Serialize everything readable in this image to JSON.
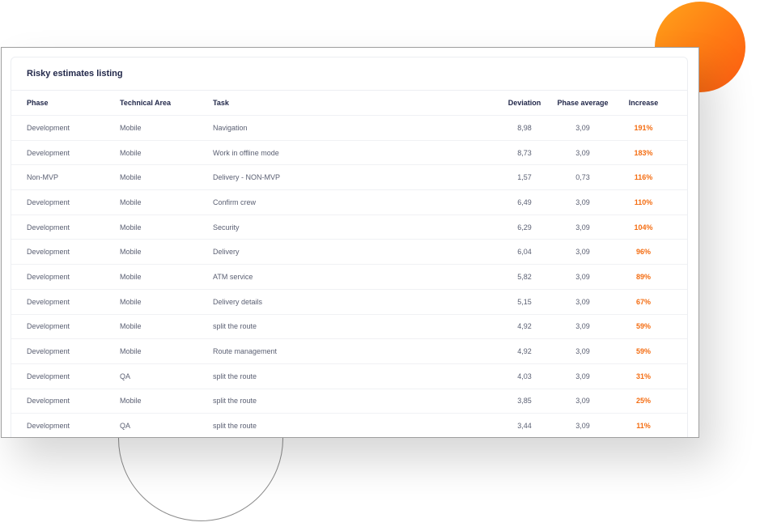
{
  "card": {
    "title": "Risky estimates listing"
  },
  "table": {
    "headers": {
      "phase": "Phase",
      "area": "Technical Area",
      "task": "Task",
      "deviation": "Deviation",
      "average": "Phase average",
      "increase": "Increase"
    },
    "rows": [
      {
        "phase": "Development",
        "area": "Mobile",
        "task": "Navigation",
        "deviation": "8,98",
        "average": "3,09",
        "increase": "191%"
      },
      {
        "phase": "Development",
        "area": "Mobile",
        "task": "Work in offline mode",
        "deviation": "8,73",
        "average": "3,09",
        "increase": "183%"
      },
      {
        "phase": "Non-MVP",
        "area": "Mobile",
        "task": "Delivery - NON-MVP",
        "deviation": "1,57",
        "average": "0,73",
        "increase": "116%"
      },
      {
        "phase": "Development",
        "area": "Mobile",
        "task": "Confirm crew",
        "deviation": "6,49",
        "average": "3,09",
        "increase": "110%"
      },
      {
        "phase": "Development",
        "area": "Mobile",
        "task": "Security",
        "deviation": "6,29",
        "average": "3,09",
        "increase": "104%"
      },
      {
        "phase": "Development",
        "area": "Mobile",
        "task": "Delivery",
        "deviation": "6,04",
        "average": "3,09",
        "increase": "96%"
      },
      {
        "phase": "Development",
        "area": "Mobile",
        "task": "ATM service",
        "deviation": "5,82",
        "average": "3,09",
        "increase": "89%"
      },
      {
        "phase": "Development",
        "area": "Mobile",
        "task": "Delivery details",
        "deviation": "5,15",
        "average": "3,09",
        "increase": "67%"
      },
      {
        "phase": "Development",
        "area": "Mobile",
        "task": "split the route",
        "deviation": "4,92",
        "average": "3,09",
        "increase": "59%"
      },
      {
        "phase": "Development",
        "area": "Mobile",
        "task": "Route management",
        "deviation": "4,92",
        "average": "3,09",
        "increase": "59%"
      },
      {
        "phase": "Development",
        "area": "QA",
        "task": "split the route",
        "deviation": "4,03",
        "average": "3,09",
        "increase": "31%"
      },
      {
        "phase": "Development",
        "area": "Mobile",
        "task": "split the route",
        "deviation": "3,85",
        "average": "3,09",
        "increase": "25%"
      },
      {
        "phase": "Development",
        "area": "QA",
        "task": "split the route",
        "deviation": "3,44",
        "average": "3,09",
        "increase": "11%"
      }
    ]
  },
  "colors": {
    "accent": "#f46d12",
    "title": "#22284a",
    "text": "#5a5f72"
  }
}
